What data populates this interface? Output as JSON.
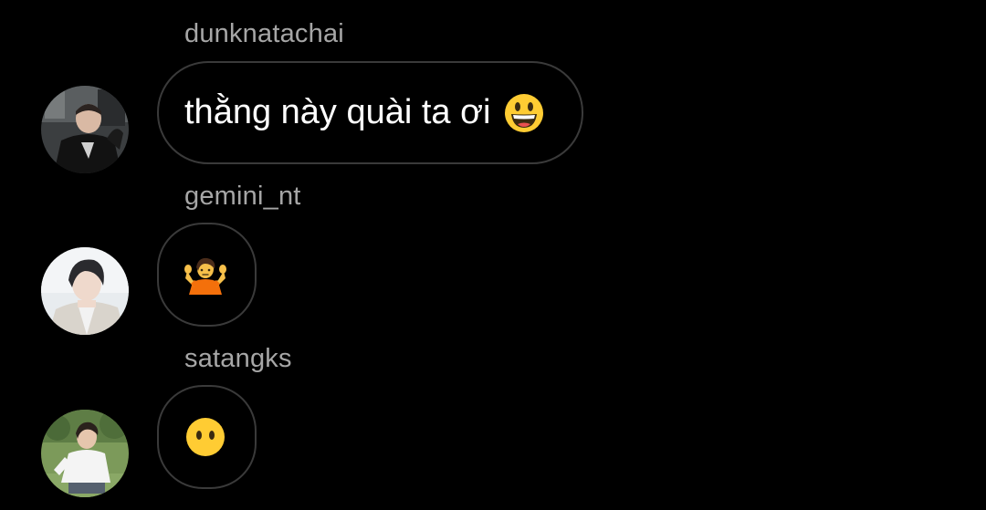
{
  "messages": [
    {
      "username": "dunknatachai",
      "text": "thằng này quài ta ơi",
      "emoji_icon": "grinning-face-icon",
      "avatar_icon": "avatar-dunknatachai"
    },
    {
      "username": "gemini_nt",
      "text": "",
      "emoji_icon": "person-shrugging-icon",
      "avatar_icon": "avatar-gemini_nt"
    },
    {
      "username": "satangks",
      "text": "",
      "emoji_icon": "face-without-mouth-icon",
      "avatar_icon": "avatar-satangks"
    }
  ],
  "colors": {
    "background": "#000000",
    "username": "#a6a6a6",
    "bubble_border": "#3a3a3a",
    "text": "#ffffff",
    "emoji_yellow": "#ffcc33"
  }
}
